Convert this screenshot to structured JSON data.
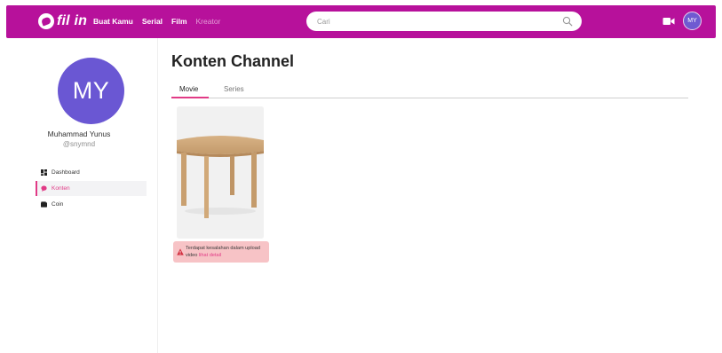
{
  "app": {
    "logo_text": "fil in"
  },
  "nav": {
    "items": [
      "Buat Kamu",
      "Serial",
      "Film",
      "Kreator"
    ]
  },
  "search": {
    "placeholder": "Cari"
  },
  "header_user": {
    "initials": "MY"
  },
  "profile": {
    "initials": "MY",
    "name": "Muhammad Yunus",
    "handle": "@snymnd"
  },
  "sidebar": {
    "items": [
      {
        "label": "Dashboard",
        "icon": "grid-icon",
        "active": false
      },
      {
        "label": "Konten",
        "icon": "chat-bubble-icon",
        "active": true
      },
      {
        "label": "Coin",
        "icon": "wallet-icon",
        "active": false
      }
    ]
  },
  "main": {
    "title": "Konten Channel",
    "tabs": [
      {
        "label": "Movie",
        "active": true
      },
      {
        "label": "Series",
        "active": false
      }
    ]
  },
  "content_card": {
    "thumbnail": "wooden-round-table",
    "error_message": "Terdapat kesalahan dalam upload video",
    "error_link": "lihat detail"
  },
  "colors": {
    "brand": "#b7119b",
    "accent": "#e13a86",
    "avatar": "#6a57d3",
    "error_bg": "#f7c3c6"
  }
}
